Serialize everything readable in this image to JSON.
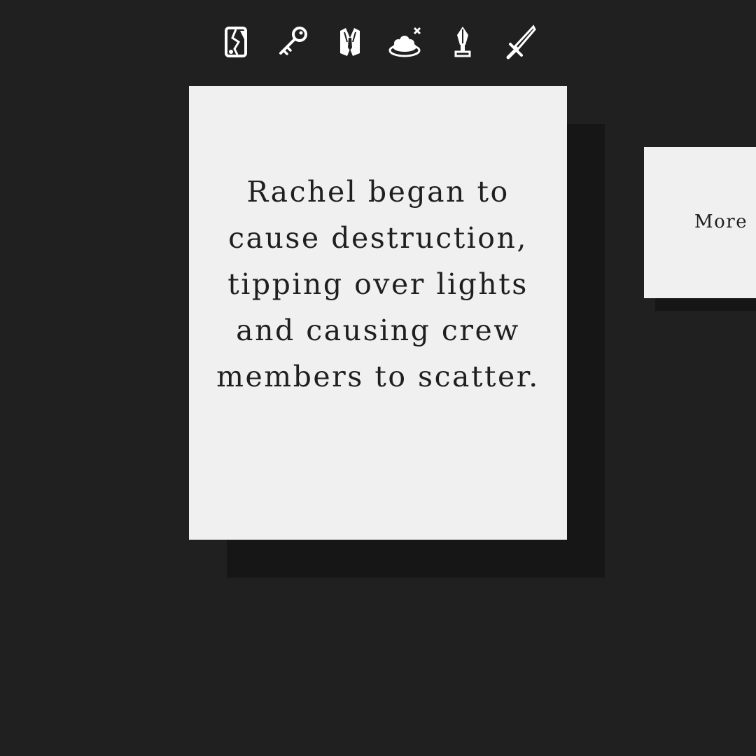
{
  "icons": [
    {
      "name": "broken-phone-icon"
    },
    {
      "name": "key-icon"
    },
    {
      "name": "suit-tie-icon"
    },
    {
      "name": "cake-cross-icon"
    },
    {
      "name": "trophy-crystal-icon"
    },
    {
      "name": "sword-icon"
    }
  ],
  "card": {
    "text": "Rachel began to cause destruction, tipping over lights and causing crew members to scatter."
  },
  "more_card": {
    "label": "More"
  },
  "colors": {
    "background": "#202020",
    "card": "#f0f0f0",
    "shadow": "#161616",
    "text": "#1f1f1f",
    "icon": "#ffffff"
  }
}
